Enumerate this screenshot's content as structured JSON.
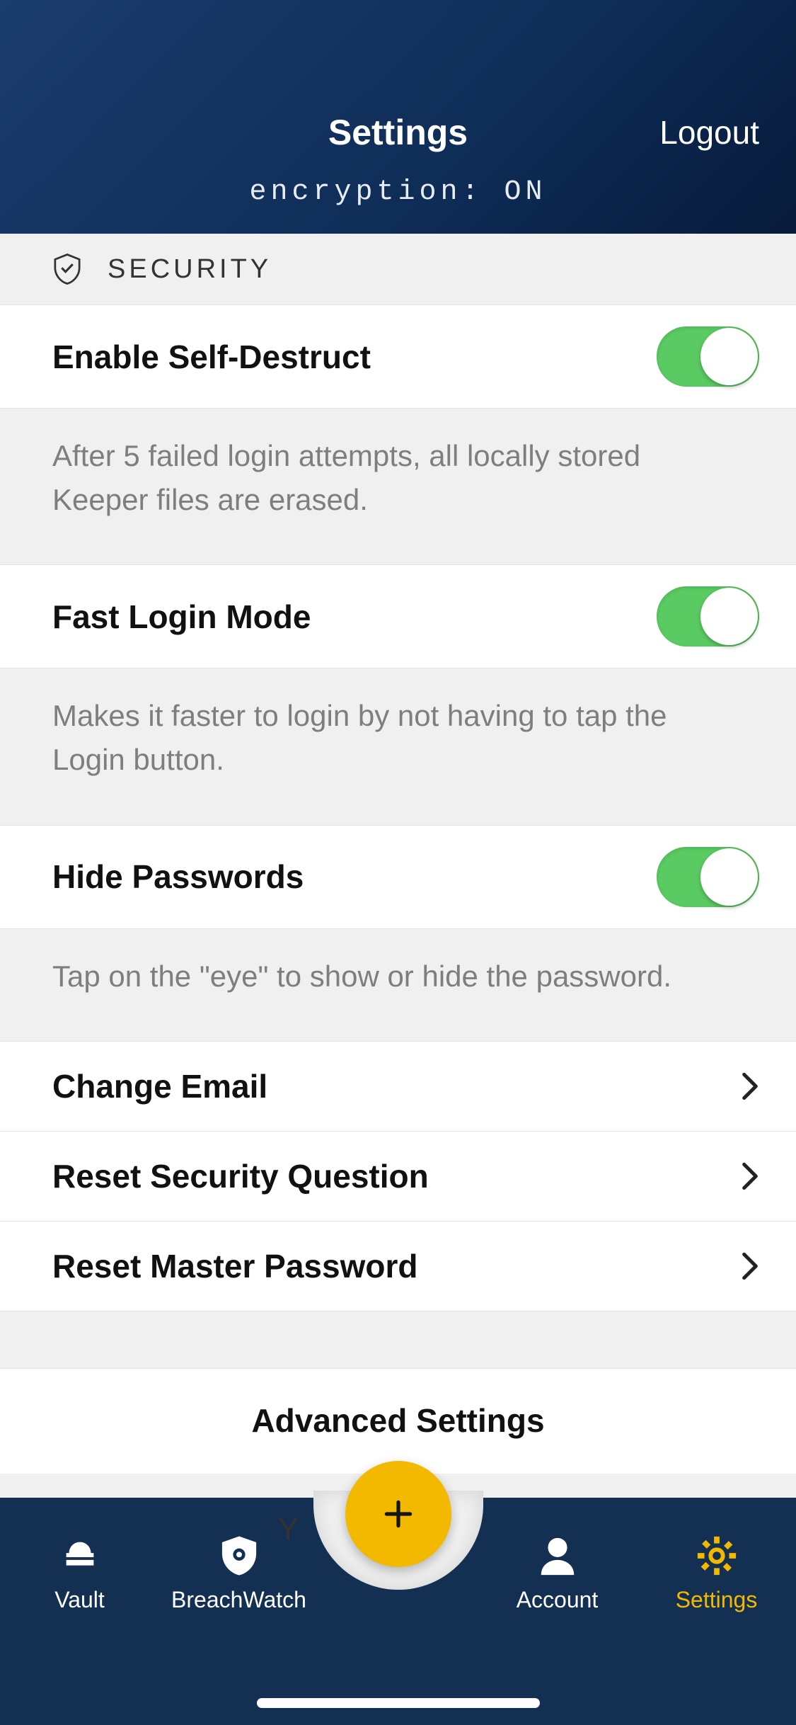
{
  "header": {
    "title": "Settings",
    "logout": "Logout",
    "encryption": "encryption: ON"
  },
  "section": {
    "title": "SECURITY"
  },
  "settings": {
    "selfDestruct": {
      "label": "Enable Self-Destruct",
      "desc": "After 5 failed login attempts, all locally stored Keeper files are erased.",
      "on": true
    },
    "fastLogin": {
      "label": "Fast Login Mode",
      "desc": "Makes it faster to login by not having to tap the Login button.",
      "on": true
    },
    "hidePasswords": {
      "label": "Hide Passwords",
      "desc": "Tap on the \"eye\" to show or hide the password.",
      "on": true
    }
  },
  "navItems": {
    "changeEmail": "Change Email",
    "resetSecurityQuestion": "Reset Security Question",
    "resetMasterPassword": "Reset Master Password"
  },
  "advanced": "Advanced Settings",
  "tabs": {
    "vault": "Vault",
    "breachwatch": "BreachWatch",
    "account": "Account",
    "settings": "Settings"
  }
}
